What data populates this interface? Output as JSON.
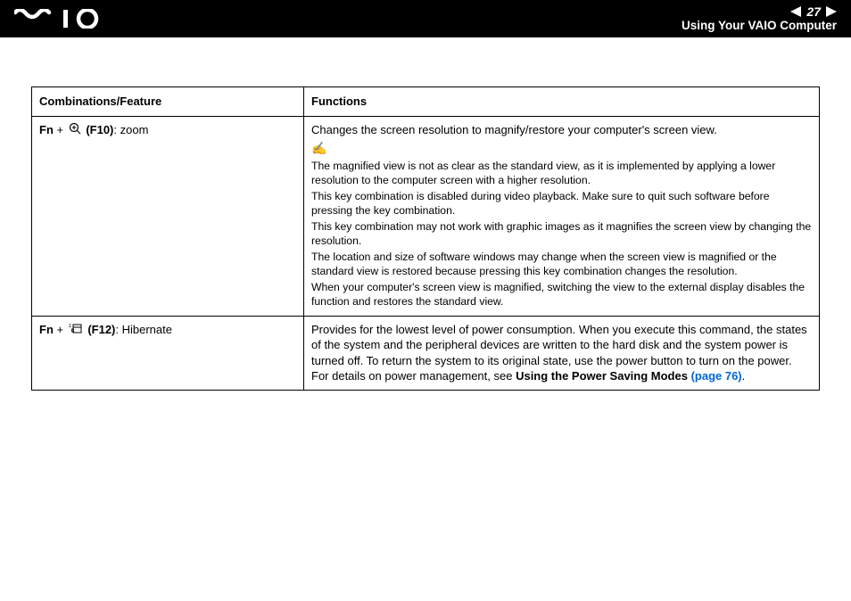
{
  "header": {
    "page_number": "27",
    "section_title": "Using Your VAIO Computer"
  },
  "table": {
    "col1_header": "Combinations/Feature",
    "col2_header": "Functions",
    "row1": {
      "fn_prefix": "Fn",
      "plus": " + ",
      "key": " (F10)",
      "label": ": zoom",
      "summary": "Changes the screen resolution to magnify/restore your computer's screen view.",
      "note_icon": "✍",
      "note1": "The magnified view is not as clear as the standard view, as it is implemented by applying a lower resolution to the computer screen with a higher resolution.",
      "note2": "This key combination is disabled during video playback. Make sure to quit such software before pressing the key combination.",
      "note3": "This key combination may not work with graphic images as it magnifies the screen view by changing the resolution.",
      "note4": "The location and size of software windows may change when the screen view is magnified or the standard view is restored because pressing this key combination changes the resolution.",
      "note5": "When your computer's screen view is magnified, switching the view to the external display disables the function and restores the standard view."
    },
    "row2": {
      "fn_prefix": "Fn",
      "plus": " + ",
      "key": " (F12)",
      "label": ": Hibernate",
      "summary": "Provides for the lowest level of power consumption. When you execute this command, the states of the system and the peripheral devices are written to the hard disk and the system power is turned off. To return the system to its original state, use the power button to turn on the power.",
      "details_prefix": "For details on power management, see ",
      "link_text": "Using the Power Saving Modes ",
      "link_page": "(page 76)",
      "period": "."
    }
  }
}
